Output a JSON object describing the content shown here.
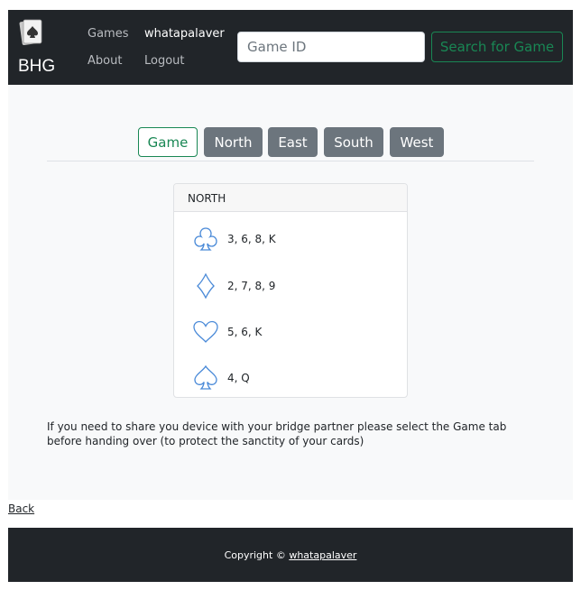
{
  "navbar": {
    "brand": "BHG",
    "links": {
      "games": "Games",
      "user": "whatapalaver",
      "about": "About",
      "logout": "Logout"
    },
    "search": {
      "placeholder": "Game ID",
      "value": "",
      "button_label": "Search for Game"
    }
  },
  "tabs": [
    {
      "label": "Game",
      "style": "outline-success"
    },
    {
      "label": "North",
      "style": "secondary"
    },
    {
      "label": "East",
      "style": "secondary"
    },
    {
      "label": "South",
      "style": "secondary"
    },
    {
      "label": "West",
      "style": "secondary"
    }
  ],
  "hand": {
    "header": "NORTH",
    "suits": [
      {
        "icon": "club-icon",
        "cards": "3, 6, 8, K"
      },
      {
        "icon": "diamond-icon",
        "cards": "2, 7, 8, 9"
      },
      {
        "icon": "heart-icon",
        "cards": "5, 6, K"
      },
      {
        "icon": "spade-icon",
        "cards": "4, Q"
      }
    ]
  },
  "notice": "If you need to share you device with your bridge partner please select the Game tab before handing over (to protect the sanctity of your cards)",
  "back_link": "Back",
  "footer": {
    "copyright_prefix": "Copyright ©",
    "author": "whatapalaver"
  },
  "colors": {
    "navbar_bg": "#212529",
    "accent_green": "#198754",
    "tab_secondary": "#6c757d",
    "suit_icon": "#4a8ad8",
    "main_bg": "#f8f9fa"
  }
}
